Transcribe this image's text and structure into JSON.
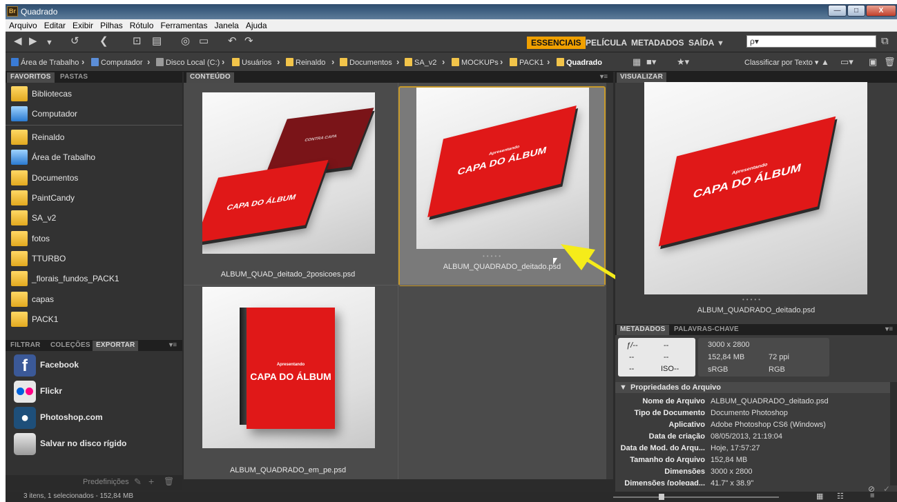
{
  "window": {
    "title": "Quadrado",
    "app_icon": "Br",
    "controls": {
      "minimize": "—",
      "maximize": "□",
      "close": "X"
    }
  },
  "menu": [
    "Arquivo",
    "Editar",
    "Exibir",
    "Pilhas",
    "Rótulo",
    "Ferramentas",
    "Janela",
    "Ajuda"
  ],
  "workspaces": [
    "ESSENCIAIS",
    "PELÍCULA",
    "METADADOS",
    "SAÍDA"
  ],
  "search": {
    "placeholder": "ρ▾"
  },
  "breadcrumb": [
    "Área de Trabalho",
    "Computador",
    "Disco Local (C:)",
    "Usuários",
    "Reinaldo",
    "Documentos",
    "SA_v2",
    "MOCKUPs",
    "PACK1",
    "Quadrado"
  ],
  "sort_label": "Classificar por Texto ▾",
  "left_tabs": {
    "favorites": "FAVORITOS",
    "folders": "PASTAS"
  },
  "favorites": [
    "Bibliotecas",
    "Computador",
    "Reinaldo",
    "Área de Trabalho",
    "Documentos",
    "PaintCandy",
    "SA_v2",
    "fotos",
    "TTURBO",
    "_florais_fundos_PACK1",
    "capas",
    "PACK1"
  ],
  "lower_tabs": {
    "filter": "FILTRAR",
    "collections": "COLEÇÕES",
    "export": "EXPORTAR"
  },
  "export_items": [
    "Facebook",
    "Flickr",
    "Photoshop.com",
    "Salvar no disco rígido"
  ],
  "presets_label": "Predefinições",
  "content_tab": "CONTEÚDO",
  "files": [
    {
      "name": "ALBUM_QUAD_deitado_2posicoes.psd",
      "cover": "CAPA DO ÁLBUM",
      "back": "CONTRA CAPA"
    },
    {
      "name": "ALBUM_QUADRADO_deitado.psd",
      "cover": "CAPA DO ÁLBUM",
      "sub": "Apresentando"
    },
    {
      "name": "ALBUM_QUADRADO_em_pe.psd",
      "cover": "CAPA DO ÁLBUM",
      "sub": "Apresentando"
    }
  ],
  "preview": {
    "tab": "VISUALIZAR",
    "filename": "ALBUM_QUADRADO_deitado.psd",
    "cover": "CAPA DO ÁLBUM",
    "sub": "Apresentando"
  },
  "meta_tabs": {
    "metadata": "METADADOS",
    "keywords": "PALAVRAS-CHAVE"
  },
  "quick": {
    "f": "ƒ/--",
    "a": "--",
    "b": "--",
    "c": "--",
    "d": "--",
    "iso": "ISO--",
    "dims": "3000 x 2800",
    "size": "152,84 MB",
    "ppi": "72 ppi",
    "profile": "sRGB",
    "mode": "RGB"
  },
  "props_header": "Propriedades do Arquivo",
  "properties": [
    {
      "label": "Nome de Arquivo",
      "value": "ALBUM_QUADRADO_deitado.psd"
    },
    {
      "label": "Tipo de Documento",
      "value": "Documento Photoshop"
    },
    {
      "label": "Aplicativo",
      "value": "Adobe Photoshop CS6 (Windows)"
    },
    {
      "label": "Data de criação",
      "value": "08/05/2013, 21:19:04"
    },
    {
      "label": "Data de Mod. do Arqu...",
      "value": "Hoje, 17:57:27"
    },
    {
      "label": "Tamanho do Arquivo",
      "value": "152,84 MB"
    },
    {
      "label": "Dimensões",
      "value": "3000 x 2800"
    },
    {
      "label": "Dimensões (polegad...",
      "value": "41,7\" x 38,9\""
    }
  ],
  "status": "3 itens, 1 selecionados - 152,84 MB",
  "colors": {
    "accent": "#f0a000",
    "selection": "#c89a2a",
    "arrow": "#f5ec1a",
    "cover": "#e01818"
  },
  "icons": {
    "back": "left-arrow-icon",
    "forward": "right-arrow-icon",
    "search": "search-icon",
    "arrow": "annotation-arrow-icon"
  }
}
